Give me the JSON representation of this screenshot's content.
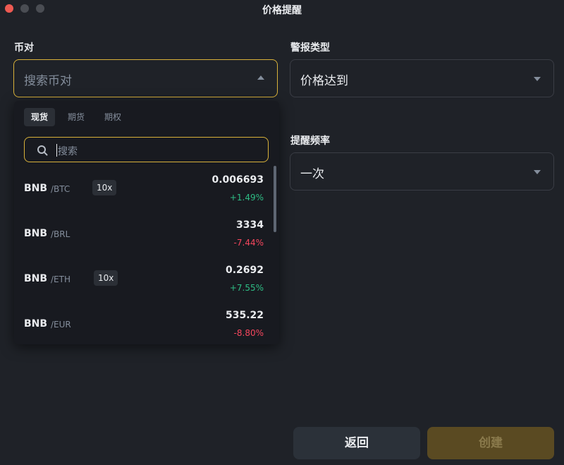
{
  "window": {
    "title": "价格提醒"
  },
  "pair_field": {
    "label": "币对",
    "placeholder": "搜索币对"
  },
  "alert_type_field": {
    "label": "警报类型",
    "value": "价格达到"
  },
  "frequency_field": {
    "label": "提醒频率",
    "value": "一次"
  },
  "dropdown": {
    "tabs": [
      {
        "label": "现货",
        "active": true
      },
      {
        "label": "期货",
        "active": false
      },
      {
        "label": "期权",
        "active": false
      }
    ],
    "search_placeholder": "搜索",
    "rows": [
      {
        "base": "BNB",
        "quote": "/BTC",
        "leverage": "10x",
        "price": "0.006693",
        "change": "+1.49%",
        "direction": "up"
      },
      {
        "base": "BNB",
        "quote": "/BRL",
        "leverage": "",
        "price": "3334",
        "change": "-7.44%",
        "direction": "down"
      },
      {
        "base": "BNB",
        "quote": "/ETH",
        "leverage": "10x",
        "price": "0.2692",
        "change": "+7.55%",
        "direction": "up"
      },
      {
        "base": "BNB",
        "quote": "/EUR",
        "leverage": "",
        "price": "535.22",
        "change": "-8.80%",
        "direction": "down"
      }
    ]
  },
  "buttons": {
    "back": "返回",
    "create": "创建"
  },
  "colors": {
    "accent": "#d8b13a",
    "up": "#2ebd85",
    "down": "#f6465d",
    "background": "#1f2228"
  }
}
